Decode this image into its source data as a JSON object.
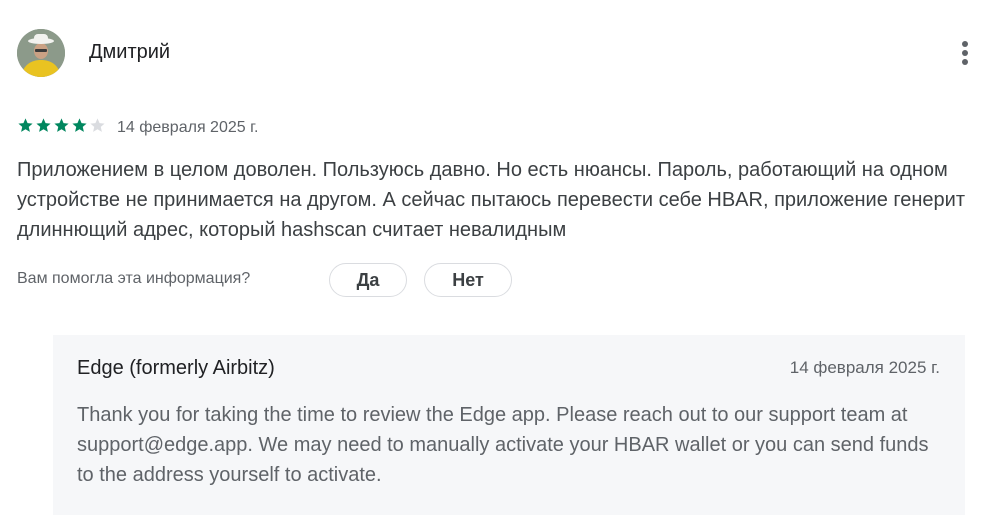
{
  "review": {
    "author": "Дмитрий",
    "rating": 4,
    "max_rating": 5,
    "date": "14 февраля 2025 г.",
    "text": "Приложением в целом доволен. Пользуюсь давно. Но есть нюансы. Пароль, работающий на одном устройстве не принимается на другом. А сейчас пытаюсь перевести себе HBAR, приложение генерит длиннющий адрес, который hashscan считает невалидным"
  },
  "helpful": {
    "question": "Вам помогла эта информация?",
    "yes_label": "Да",
    "no_label": "Нет"
  },
  "developer_reply": {
    "author": "Edge (formerly Airbitz)",
    "date": "14 февраля 2025 г.",
    "text": "Thank you for taking the time to review the Edge app. Please reach out to our support team at support@edge.app. We may need to manually activate your HBAR wallet or you can send funds to the address yourself to activate."
  },
  "colors": {
    "star_filled": "#01875f",
    "star_empty": "#dadce0"
  },
  "icons": {
    "more": "more-vert-icon",
    "star": "star-icon"
  }
}
